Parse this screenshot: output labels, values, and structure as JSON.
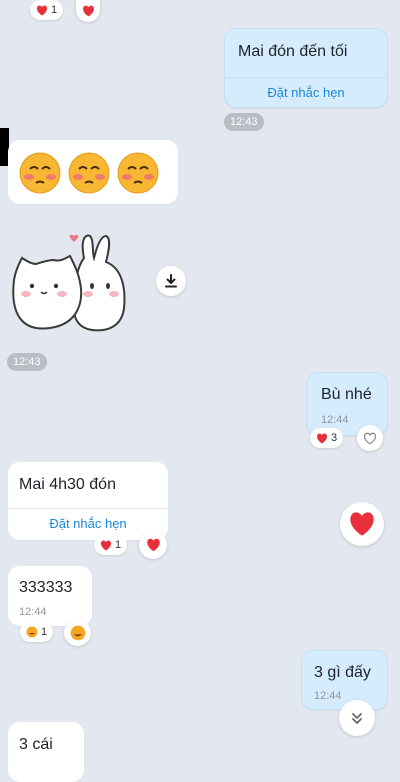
{
  "messages": {
    "top_reaction": {
      "count": "1"
    },
    "sent_mai_don": {
      "text": "Mai đón đến tối",
      "action": "Đặt nhắc hẹn",
      "time": "12:43"
    },
    "sticker_time": {
      "time": "12:43"
    },
    "sent_bu_nhe": {
      "text": "Bù nhé",
      "time": "12:44",
      "reaction_count": "3"
    },
    "recv_mai_4h30": {
      "text": "Mai 4h30 đón",
      "action": "Đặt nhắc hẹn",
      "reaction_count": "1"
    },
    "recv_333333": {
      "text": "333333",
      "time": "12:44",
      "reaction_count": "1"
    },
    "sent_3_gi": {
      "text": "3 gì đấy",
      "time": "12:44"
    },
    "recv_3_cai": {
      "text": "3 cái"
    }
  },
  "colors": {
    "background": "#e3e7ef",
    "sent_bubble": "#d5ecfd",
    "received_bubble": "#ffffff",
    "link": "#1a88d8",
    "heart": "#e8303b"
  },
  "icons": {
    "heart": "heart-icon",
    "download": "download-icon",
    "scroll_down": "double-chevron-down-icon",
    "blush_emoji": "blushing-face-icon",
    "sticker": "cat-bunny-sticker"
  }
}
